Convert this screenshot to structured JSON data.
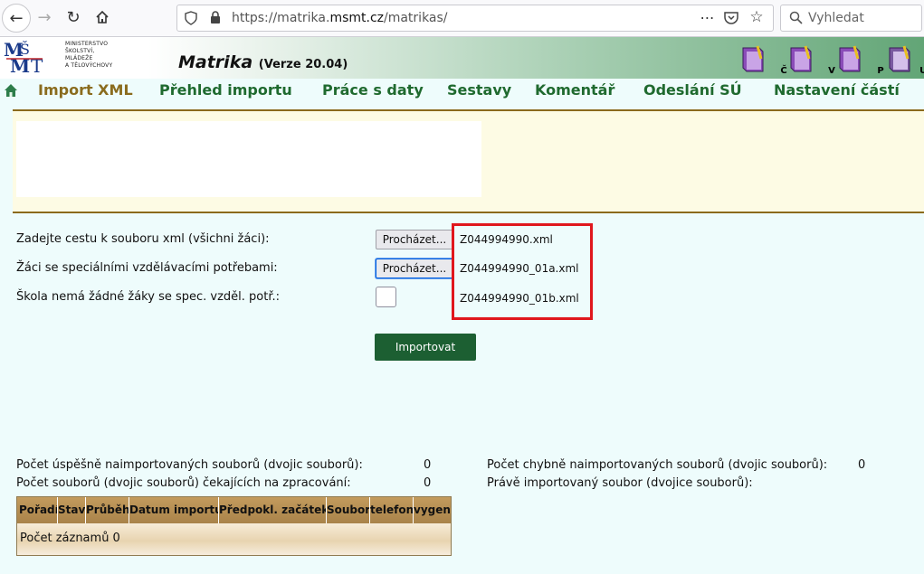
{
  "browser": {
    "url_prefix": "https://matrika.",
    "url_domain": "msmt.cz",
    "url_path": "/matrikas/",
    "search_placeholder": "Vyhledat"
  },
  "header": {
    "ministry_lines": [
      "MINISTERSTVO",
      "ŠKOLSTVÍ,",
      "MLÁDEŽE",
      "A TĚLOVÝCHOVY"
    ],
    "app_title": "Matrika",
    "app_version": "(Verze 20.04)",
    "icons": [
      {
        "label": "Č",
        "color": "#7a3ea8"
      },
      {
        "label": "V",
        "color": "#7a3ea8"
      },
      {
        "label": "P",
        "color": "#7a3ea8"
      },
      {
        "label": "UCH",
        "color": "#6a4a8a"
      }
    ]
  },
  "menu": {
    "items": [
      "Import XML",
      "Přehled importu",
      "Práce s daty",
      "Sestavy",
      "Komentář",
      "Odeslání SÚ",
      "Nastavení částí"
    ]
  },
  "form": {
    "row1_label": "Zadejte cestu k souboru xml (všichni žáci):",
    "row2_label": "Žáci se speciálními vzdělávacími potřebami:",
    "row3_label": "Škola nemá žádné žáky se spec. vzděl. potř.:",
    "browse_label": "Procházet...",
    "file1": "Z044994990.xml",
    "file2": "Z044994990_01a.xml",
    "file3": "Z044994990_01b.xml",
    "import_label": "Importovat"
  },
  "stats": {
    "ok_label": "Počet úspěšně naimportovaných souborů (dvojic souborů):",
    "ok_value": "0",
    "waiting_label": "Počet souborů (dvojic souborů) čekajících na zpracování:",
    "waiting_value": "0",
    "err_label": "Počet chybně naimportovaných souborů (dvojic souborů):",
    "err_value": "0",
    "current_label": "Právě importovaný soubor (dvojice souborů):"
  },
  "table": {
    "headers": [
      "Pořadí",
      "Stav",
      "Průběh",
      "Datum importu",
      "Předpokl. začátek",
      "Soubor",
      "telefon",
      "vygen"
    ],
    "footer": "Počet záznamů 0"
  }
}
